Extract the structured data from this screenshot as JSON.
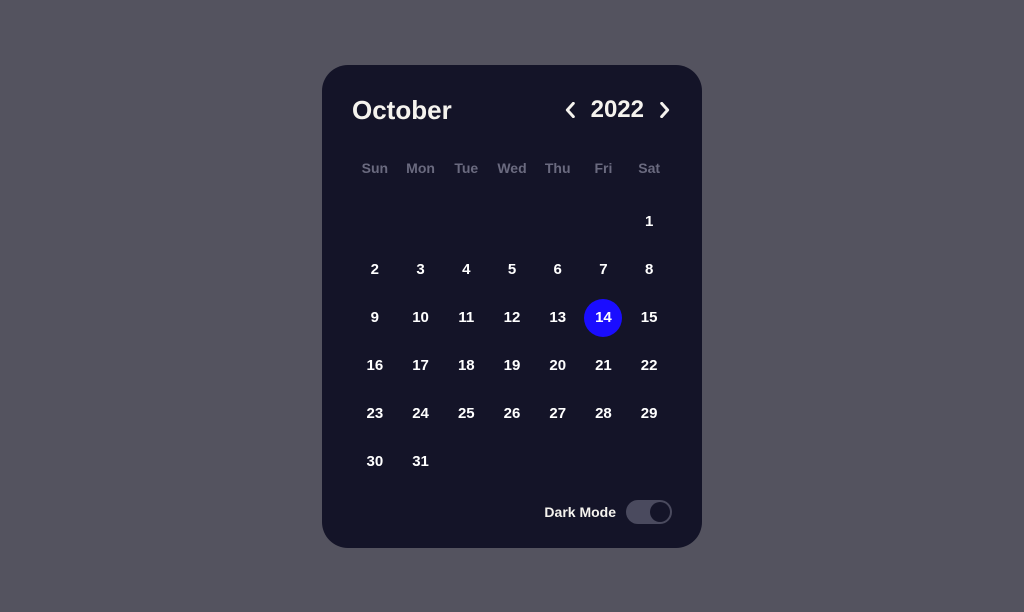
{
  "header": {
    "month": "October",
    "year": "2022"
  },
  "weekdays": [
    "Sun",
    "Mon",
    "Tue",
    "Wed",
    "Thu",
    "Fri",
    "Sat"
  ],
  "days": [
    "",
    "",
    "",
    "",
    "",
    "",
    "1",
    "2",
    "3",
    "4",
    "5",
    "6",
    "7",
    "8",
    "9",
    "10",
    "11",
    "12",
    "13",
    "14",
    "15",
    "16",
    "17",
    "18",
    "19",
    "20",
    "21",
    "22",
    "23",
    "24",
    "25",
    "26",
    "27",
    "28",
    "29",
    "30",
    "31"
  ],
  "selected_day": "14",
  "footer": {
    "dark_mode_label": "Dark Mode",
    "dark_mode_on": true
  },
  "colors": {
    "background": "#54535f",
    "card": "#141428",
    "accent": "#1a0dff",
    "text": "#ffffff",
    "muted": "#6a6a7f"
  }
}
